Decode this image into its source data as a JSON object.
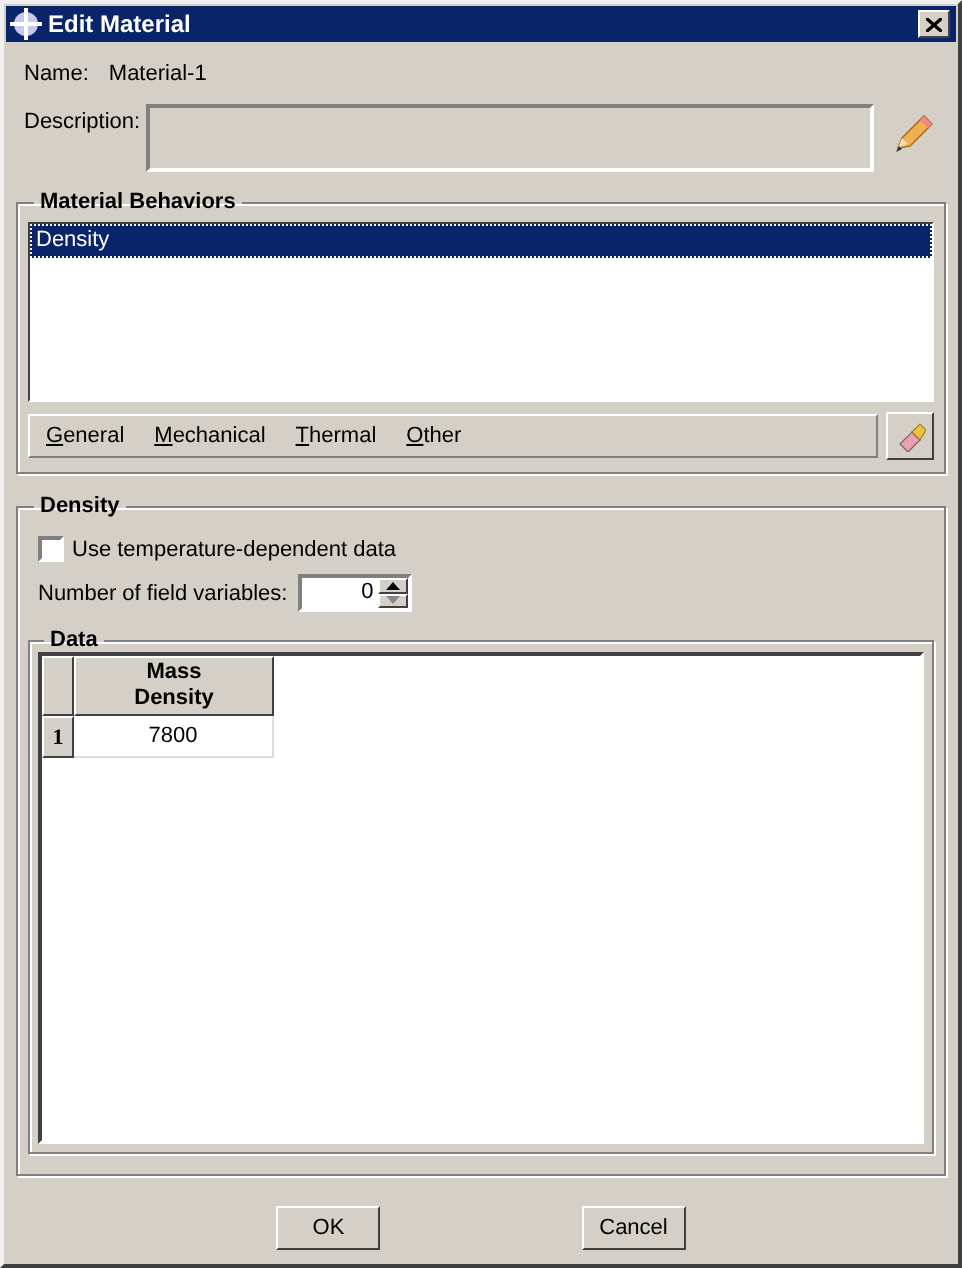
{
  "window": {
    "title": "Edit Material"
  },
  "name": {
    "label": "Name:",
    "value": "Material-1"
  },
  "description": {
    "label": "Description:"
  },
  "material_behaviors": {
    "title": "Material Behaviors",
    "items": [
      {
        "label": "Density",
        "selected": true
      }
    ],
    "menus": [
      "General",
      "Mechanical",
      "Thermal",
      "Other"
    ]
  },
  "density": {
    "title": "Density",
    "temperature_dependent": {
      "label": "Use temperature-dependent data",
      "checked": false
    },
    "field_variables": {
      "label": "Number of field variables:",
      "value": "0"
    },
    "data": {
      "title": "Data",
      "columns": [
        "Mass Density"
      ],
      "rows": [
        {
          "number": "1",
          "cells": [
            "7800"
          ]
        }
      ]
    }
  },
  "buttons": [
    "OK",
    "Cancel"
  ]
}
